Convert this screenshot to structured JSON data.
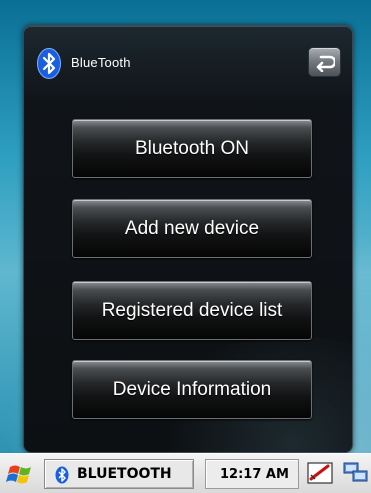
{
  "app": {
    "title": "BlueTooth",
    "icon": "bluetooth-icon",
    "back_icon": "back-arrow-icon"
  },
  "menu": {
    "buttons": [
      {
        "label": "Bluetooth ON"
      },
      {
        "label": "Add new device"
      },
      {
        "label": "Registered device list"
      },
      {
        "label": "Device Information"
      }
    ]
  },
  "taskbar": {
    "start_icon": "windows-flag-icon",
    "task_label": "BLUETOOTH",
    "task_icon": "bluetooth-icon",
    "clock": "12:17 AM",
    "tray_icons": [
      "input-panel-icon",
      "network-icon"
    ]
  },
  "colors": {
    "bluetooth_blue": "#1a5fe0",
    "panel_bg": "#101418",
    "wallpaper": "#2f9fc1"
  }
}
